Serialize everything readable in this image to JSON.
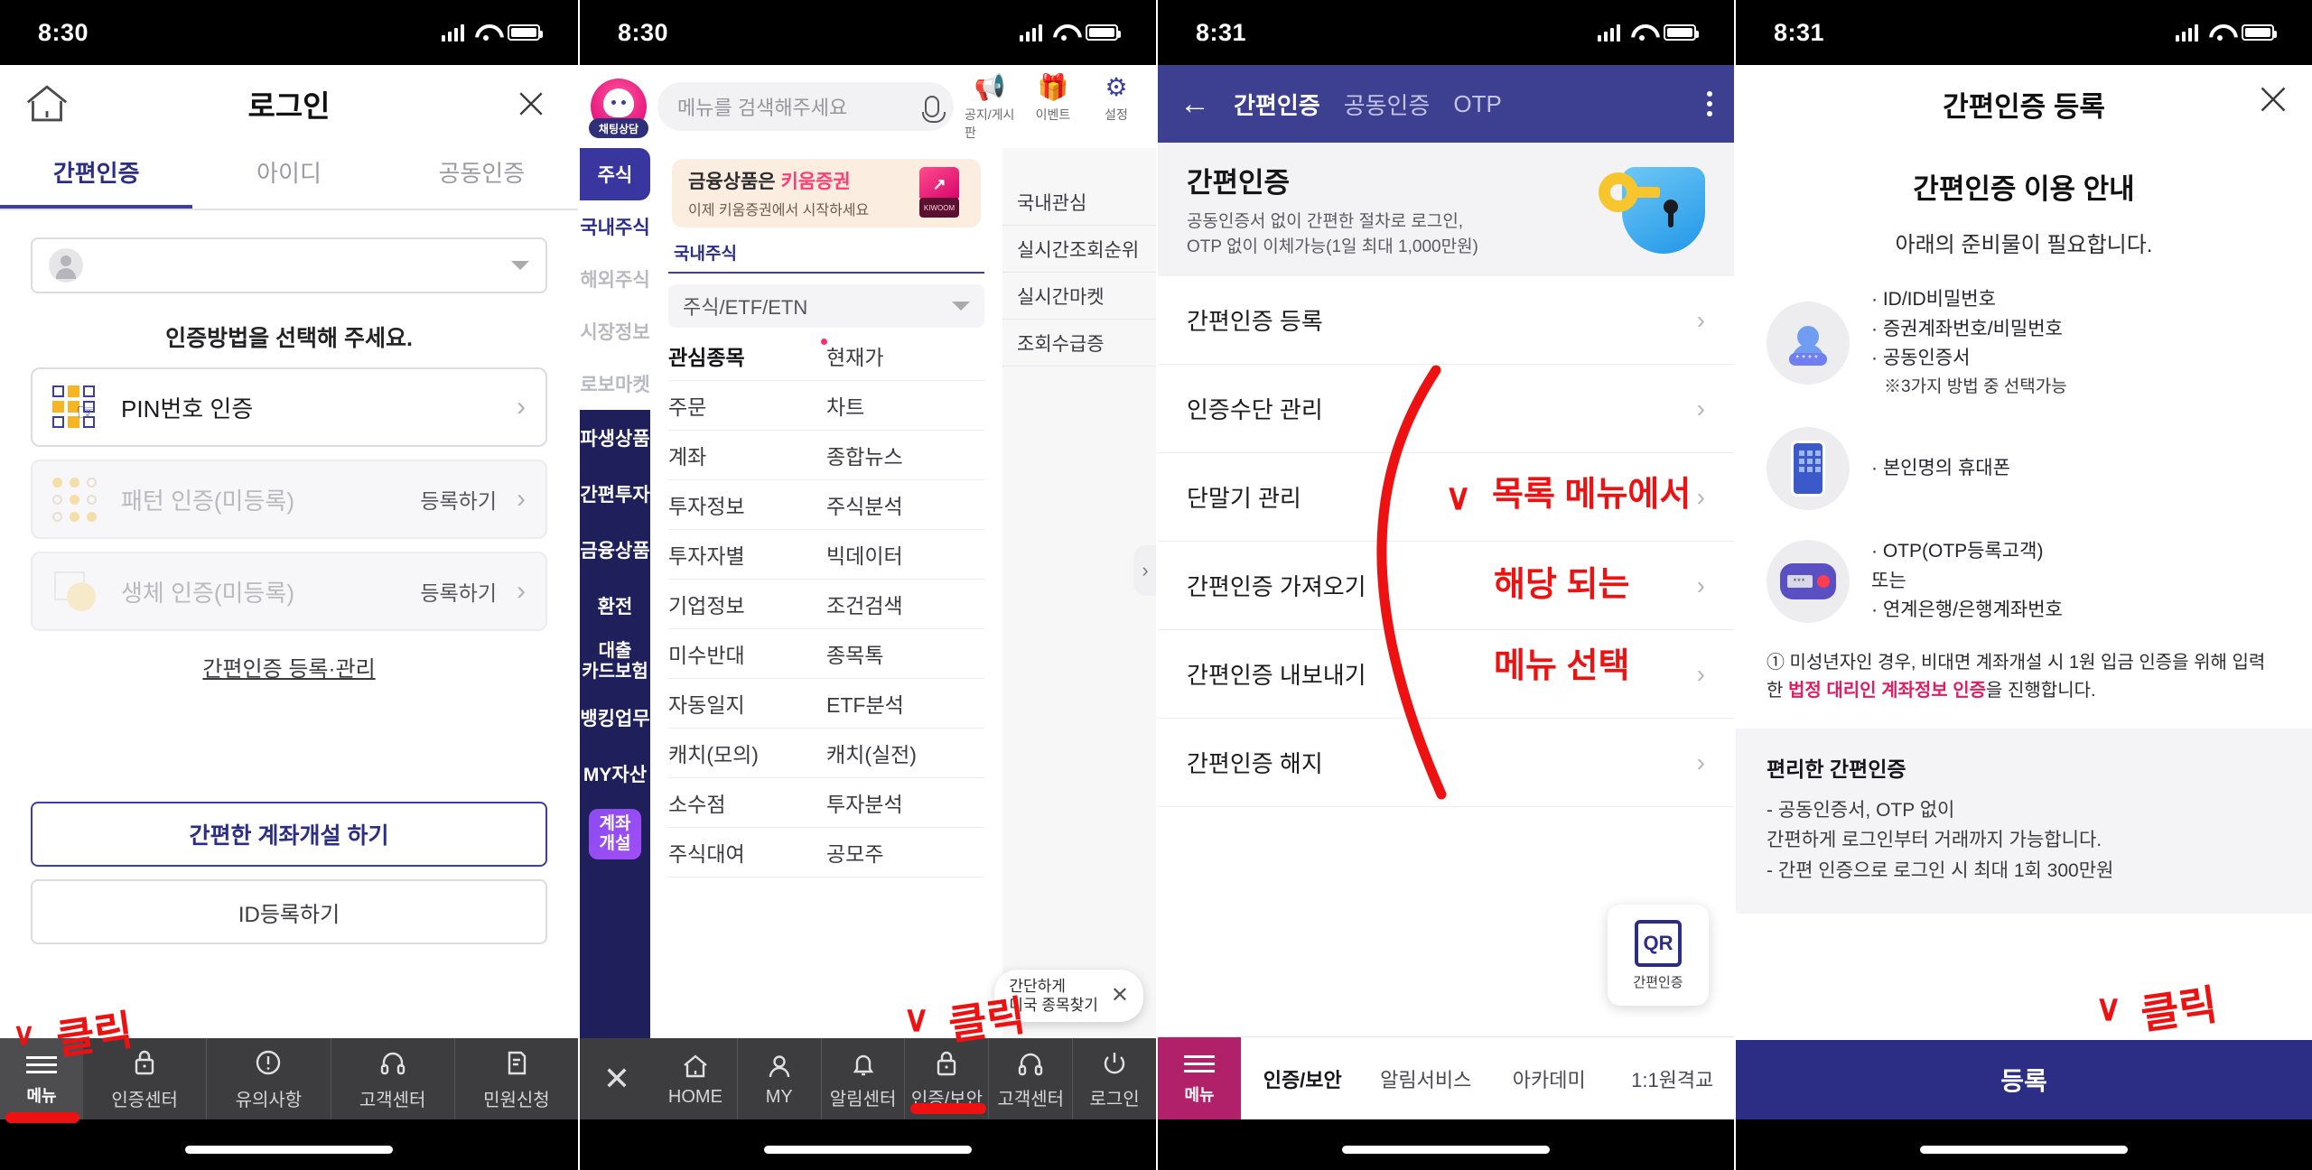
{
  "panel1": {
    "status": {
      "time": "8:30"
    },
    "header": {
      "title": "로그인",
      "home_icon": "home-icon",
      "close_icon": "close-icon"
    },
    "tabs": [
      {
        "label": "간편인증",
        "active": true
      },
      {
        "label": "아이디",
        "active": false
      },
      {
        "label": "공동인증",
        "active": false
      }
    ],
    "account_select": {
      "value": "",
      "placeholder": ""
    },
    "prompt": "인증방법을 선택해 주세요.",
    "auth_methods": [
      {
        "label": "PIN번호 인증",
        "icon": "pin-grid-icon",
        "extra": "",
        "disabled": false
      },
      {
        "label": "패턴 인증(미등록)",
        "icon": "pattern-icon",
        "extra": "등록하기",
        "disabled": true
      },
      {
        "label": "생체 인증(미등록)",
        "icon": "biometric-icon",
        "extra": "등록하기",
        "disabled": true
      }
    ],
    "manage_link": "간편인증 등록·관리",
    "cta_primary": "간편한 계좌개설 하기",
    "cta_secondary": "ID등록하기",
    "bottom_nav": {
      "menu_label": "메뉴",
      "items": [
        {
          "label": "인증센터",
          "icon": "lock-icon"
        },
        {
          "label": "유의사항",
          "icon": "exclamation-icon"
        },
        {
          "label": "고객센터",
          "icon": "headset-icon"
        },
        {
          "label": "민원신청",
          "icon": "document-pen-icon"
        }
      ]
    },
    "annotation": {
      "check": "∨",
      "text": "클릭"
    }
  },
  "panel2": {
    "status": {
      "time": "8:30"
    },
    "chatbot": {
      "label": "채팅상담"
    },
    "search": {
      "placeholder": "메뉴를 검색해주세요",
      "mic_icon": "mic-icon"
    },
    "top_icons": [
      {
        "label": "공지/게시판",
        "icon": "megaphone-icon"
      },
      {
        "label": "이벤트",
        "icon": "gift-icon"
      },
      {
        "label": "설정",
        "icon": "gear-icon"
      }
    ],
    "sidebar_top": [
      {
        "label": "주식",
        "state": "selected"
      },
      {
        "label": "국내주식",
        "state": "highlight"
      },
      {
        "label": "해외주식",
        "state": "normal"
      },
      {
        "label": "시장정보",
        "state": "normal"
      },
      {
        "label": "로보마켓",
        "state": "normal"
      }
    ],
    "sidebar_bottom": [
      {
        "label": "파생상품"
      },
      {
        "label": "간편투자"
      },
      {
        "label": "금융상품"
      },
      {
        "label": "환전"
      },
      {
        "label": "대출\n카드보험"
      },
      {
        "label": "뱅킹업무"
      },
      {
        "label": "MY자산"
      }
    ],
    "account_open_button": "계좌\n개설",
    "banner": {
      "title_plain": "금융상품은 ",
      "title_accent": "키움증권",
      "subtitle": "이제 키움증권에서 시작하세요",
      "cube_label": "KIWOOM"
    },
    "section_title": "국내주식",
    "dropdown": {
      "value": "주식/ETF/ETN"
    },
    "grid": [
      {
        "left": "관심종목",
        "right": "현재가",
        "left_bold": true,
        "right_dot": true
      },
      {
        "left": "주문",
        "right": "차트"
      },
      {
        "left": "계좌",
        "right": "종합뉴스"
      },
      {
        "left": "투자정보",
        "right": "주식분석"
      },
      {
        "left": "투자자별",
        "right": "빅데이터"
      },
      {
        "left": "기업정보",
        "right": "조건검색"
      },
      {
        "left": "미수반대",
        "right": "종목톡"
      },
      {
        "left": "자동일지",
        "right": "ETF분석"
      },
      {
        "left": "캐치(모의)",
        "right": "캐치(실전)"
      },
      {
        "left": "소수점",
        "right": "투자분석"
      },
      {
        "left": "주식대여",
        "right": "공모주"
      }
    ],
    "right_column": [
      "국내관심",
      "실시간조회순위",
      "실시간마켓",
      "조회수급증"
    ],
    "tooltip": {
      "line1": "간단하게",
      "line2": "미국 종목찾기",
      "close": "✕"
    },
    "bottom_nav": {
      "close_icon": "close-icon",
      "items": [
        {
          "label": "HOME",
          "icon": "home-icon"
        },
        {
          "label": "MY",
          "icon": "person-icon"
        },
        {
          "label": "알림센터",
          "icon": "bell-icon"
        },
        {
          "label": "인증/보안",
          "icon": "lock-icon"
        },
        {
          "label": "고객센터",
          "icon": "headset-icon"
        },
        {
          "label": "로그인",
          "icon": "power-icon"
        }
      ]
    },
    "annotation": {
      "check": "∨",
      "text": "클릭"
    }
  },
  "panel3": {
    "status": {
      "time": "8:31"
    },
    "header": {
      "back_icon": "back-arrow-icon",
      "tabs": [
        {
          "label": "간편인증",
          "active": true
        },
        {
          "label": "공동인증",
          "active": false
        },
        {
          "label": "OTP",
          "active": false
        }
      ],
      "kebab_icon": "kebab-menu-icon"
    },
    "hero": {
      "title": "간편인증",
      "line1": "공동인증서 없이 간편한 절차로 로그인,",
      "line2": "OTP 없이 이체가능(1일 최대 1,000만원)",
      "icon": "shield-key-icon"
    },
    "menu": [
      "간편인증 등록",
      "인증수단 관리",
      "단말기 관리",
      "간편인증 가져오기",
      "간편인증 내보내기",
      "간편인증 해지"
    ],
    "qr_badge": {
      "glyph": "QR",
      "label": "간편인증"
    },
    "bottom": {
      "menu_label": "메뉴",
      "items": [
        {
          "label": "인증/보안",
          "active": true
        },
        {
          "label": "알림서비스",
          "active": false
        },
        {
          "label": "아카데미",
          "active": false
        },
        {
          "label": "1:1원격교",
          "active": false
        }
      ]
    },
    "annotation": {
      "check": "∨",
      "line1": "목록 메뉴에서",
      "line2": "해당 되는",
      "line3": "메뉴 선택"
    }
  },
  "panel4": {
    "status": {
      "time": "8:31"
    },
    "header": {
      "title": "간편인증 등록",
      "close_icon": "close-icon"
    },
    "guide_title": "간편인증 이용 안내",
    "guide_sub": "아래의 준비물이 필요합니다.",
    "requirements": [
      {
        "icon": "user-password-icon",
        "lines": [
          "· ID/ID비밀번호",
          "· 증권계좌번호/비밀번호",
          "· 공동인증서"
        ],
        "note": "※3가지 방법 중 선택가능"
      },
      {
        "icon": "mobile-phone-icon",
        "lines": [
          "· 본인명의 휴대폰"
        ],
        "note": ""
      },
      {
        "icon": "otp-token-icon",
        "lines": [
          "· OTP(OTP등록고객)",
          "또는",
          "· 연계은행/은행계좌번호"
        ],
        "note": ""
      }
    ],
    "warning": {
      "prefix": "① 미성년자인 경우, 비대면 계좌개설 시 1원 입금 인증을 위해 입력한 ",
      "accent": "법정 대리인 계좌정보 인증",
      "suffix": "을 진행합니다."
    },
    "card": {
      "title": "편리한 간편인증",
      "line1": "- 공동인증서, OTP 없이",
      "line2": "  간편하게 로그인부터 거래까지 가능합니다.",
      "line3": "- 간편 인증으로 로그인 시 최대 1회 300만원"
    },
    "submit_button": "등록",
    "annotation": {
      "check": "∨",
      "text": "클릭"
    }
  }
}
